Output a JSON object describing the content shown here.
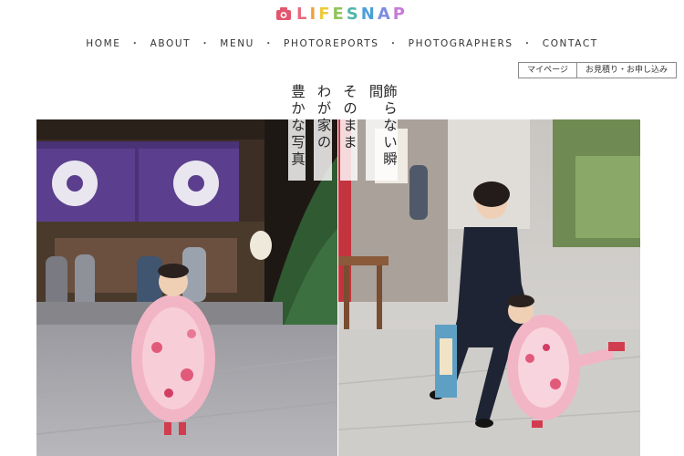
{
  "brand": {
    "letters": [
      {
        "ch": "L",
        "color": "#e86a7f"
      },
      {
        "ch": "I",
        "color": "#f0a13a"
      },
      {
        "ch": "F",
        "color": "#eccb3c"
      },
      {
        "ch": "E",
        "color": "#8fc45a"
      },
      {
        "ch": "S",
        "color": "#4fb7a8"
      },
      {
        "ch": "N",
        "color": "#4a9fd8"
      },
      {
        "ch": "A",
        "color": "#7d8de0"
      },
      {
        "ch": "P",
        "color": "#c77ad6"
      }
    ]
  },
  "nav": {
    "items": [
      {
        "label": "HOME",
        "key": "home"
      },
      {
        "label": "ABOUT",
        "key": "about"
      },
      {
        "label": "MENU",
        "key": "menu"
      },
      {
        "label": "PHOTOREPORTS",
        "key": "photoreports"
      },
      {
        "label": "PHOTOGRAPHERS",
        "key": "photographers"
      },
      {
        "label": "CONTACT",
        "key": "contact"
      }
    ],
    "separator": "・"
  },
  "utility": {
    "mypage_label": "マイページ",
    "estimate_label": "お見積り・お申し込み"
  },
  "hero": {
    "tagline_lines": [
      "飾らない瞬間",
      "そのまま",
      "わが家の",
      "豊かな写真"
    ]
  },
  "colors": {
    "camera_icon": "#e2566d",
    "nav_text": "#333333",
    "curtain_purple": "#5b3f8e"
  }
}
